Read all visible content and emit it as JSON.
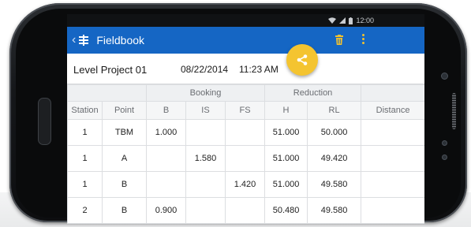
{
  "status_bar": {
    "time": "12:00"
  },
  "app_bar": {
    "title": "Fieldbook"
  },
  "project": {
    "name": "Level Project 01",
    "date": "08/22/2014",
    "time": "11:23 AM"
  },
  "table": {
    "groups": {
      "booking": "Booking",
      "reduction": "Reduction"
    },
    "columns": [
      "Station",
      "Point",
      "B",
      "IS",
      "FS",
      "H",
      "RL",
      "Distance"
    ],
    "rows": [
      [
        "1",
        "TBM",
        "1.000",
        "",
        "",
        "51.000",
        "50.000",
        ""
      ],
      [
        "1",
        "A",
        "",
        "1.580",
        "",
        "51.000",
        "49.420",
        ""
      ],
      [
        "1",
        "B",
        "",
        "",
        "1.420",
        "51.000",
        "49.580",
        ""
      ],
      [
        "2",
        "B",
        "0.900",
        "",
        "",
        "50.480",
        "49.580",
        ""
      ]
    ]
  },
  "colors": {
    "app_bar": "#1566c4",
    "accent": "#f4c430",
    "trash": "#f2c12e"
  },
  "icons": [
    "back-chevron-icon",
    "menu-icon",
    "trash-icon",
    "overflow-menu-icon",
    "share-icon",
    "wifi-icon",
    "signal-icon",
    "battery-icon"
  ]
}
